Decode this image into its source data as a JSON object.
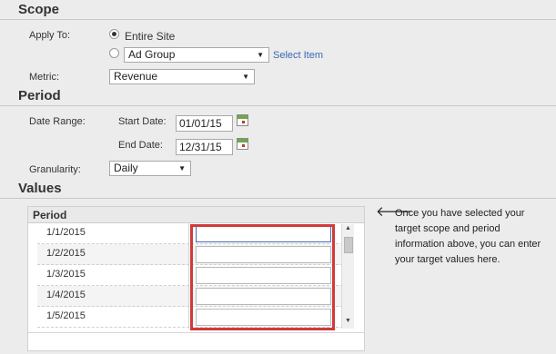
{
  "scope": {
    "title": "Scope",
    "apply_to_label": "Apply To:",
    "option_entire_site": "Entire Site",
    "ad_group_select": "Ad Group",
    "select_item_link": "Select Item",
    "metric_label": "Metric:",
    "metric_select": "Revenue"
  },
  "period": {
    "title": "Period",
    "date_range_label": "Date Range:",
    "start_date_label": "Start Date:",
    "start_date_value": "01/01/15",
    "end_date_label": "End Date:",
    "end_date_value": "12/31/15",
    "granularity_label": "Granularity:",
    "granularity_select": "Daily"
  },
  "values": {
    "title": "Values",
    "grid_header": "Period",
    "rows": [
      "1/1/2015",
      "1/2/2015",
      "1/3/2015",
      "1/4/2015",
      "1/5/2015"
    ],
    "note": "Once you have selected your target scope and period information above, you can enter your target values here."
  },
  "icons": {
    "select_arrow": "▼",
    "note_arrow": "🡐",
    "scroll_up": "▲",
    "scroll_down": "▼"
  },
  "colors": {
    "highlight_box": "#d03a3a",
    "link": "#3a66b8"
  }
}
